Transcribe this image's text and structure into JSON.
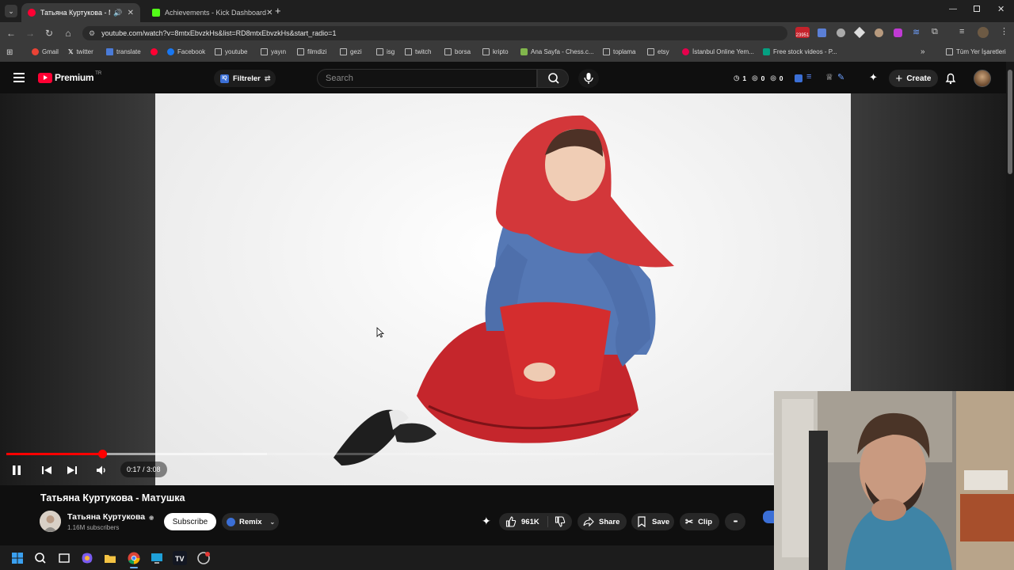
{
  "browser": {
    "tabs": [
      {
        "title": "Татьяна Куртукова - Матуш",
        "active": true
      },
      {
        "title": "Achievements - Kick Dashboard",
        "active": false
      }
    ],
    "new_tab": "+",
    "url": "youtube.com/watch?v=8mtxEbvzkHs&list=RD8mtxEbvzkHs&start_radio=1",
    "bookmarks": [
      "Gmail",
      "twitter",
      "translate",
      "Facebook",
      "youtube",
      "yayın",
      "filmdizi",
      "gezi",
      "isg",
      "twitch",
      "borsa",
      "kripto",
      "Ana Sayfa - Chess.c...",
      "toplama",
      "etsy",
      "İstanbul Online Yem...",
      "Free stock videos - P..."
    ],
    "bookmarks_more": "»",
    "all_bookmarks": "Tüm Yer İşaretleri",
    "extension_badge": "23951"
  },
  "youtube": {
    "logo_text": "Premium",
    "logo_region": "TR",
    "filter_label": "Filtreler",
    "search_placeholder": "Search",
    "stats": {
      "a": "1",
      "b": "0",
      "c": "0"
    },
    "create_label": "Create"
  },
  "player": {
    "time_current": "0:17",
    "time_sep": " / ",
    "time_total": "3:08",
    "progress": 0.125,
    "buffered": 0.34
  },
  "video": {
    "title": "Татьяна Куртукова - Матушка",
    "channel": "Татьяна Куртукова",
    "verified": "◉",
    "subscribers": "1.16M subscribers",
    "subscribe_label": "Subscribe",
    "remix_label": "Remix",
    "likes": "961K",
    "share_label": "Share",
    "save_label": "Save",
    "clip_label": "Clip",
    "more_label": "•••"
  },
  "colors": {
    "accent": "#ff0000",
    "youtube_red": "#ff0033",
    "kick_green": "#53fc18"
  }
}
